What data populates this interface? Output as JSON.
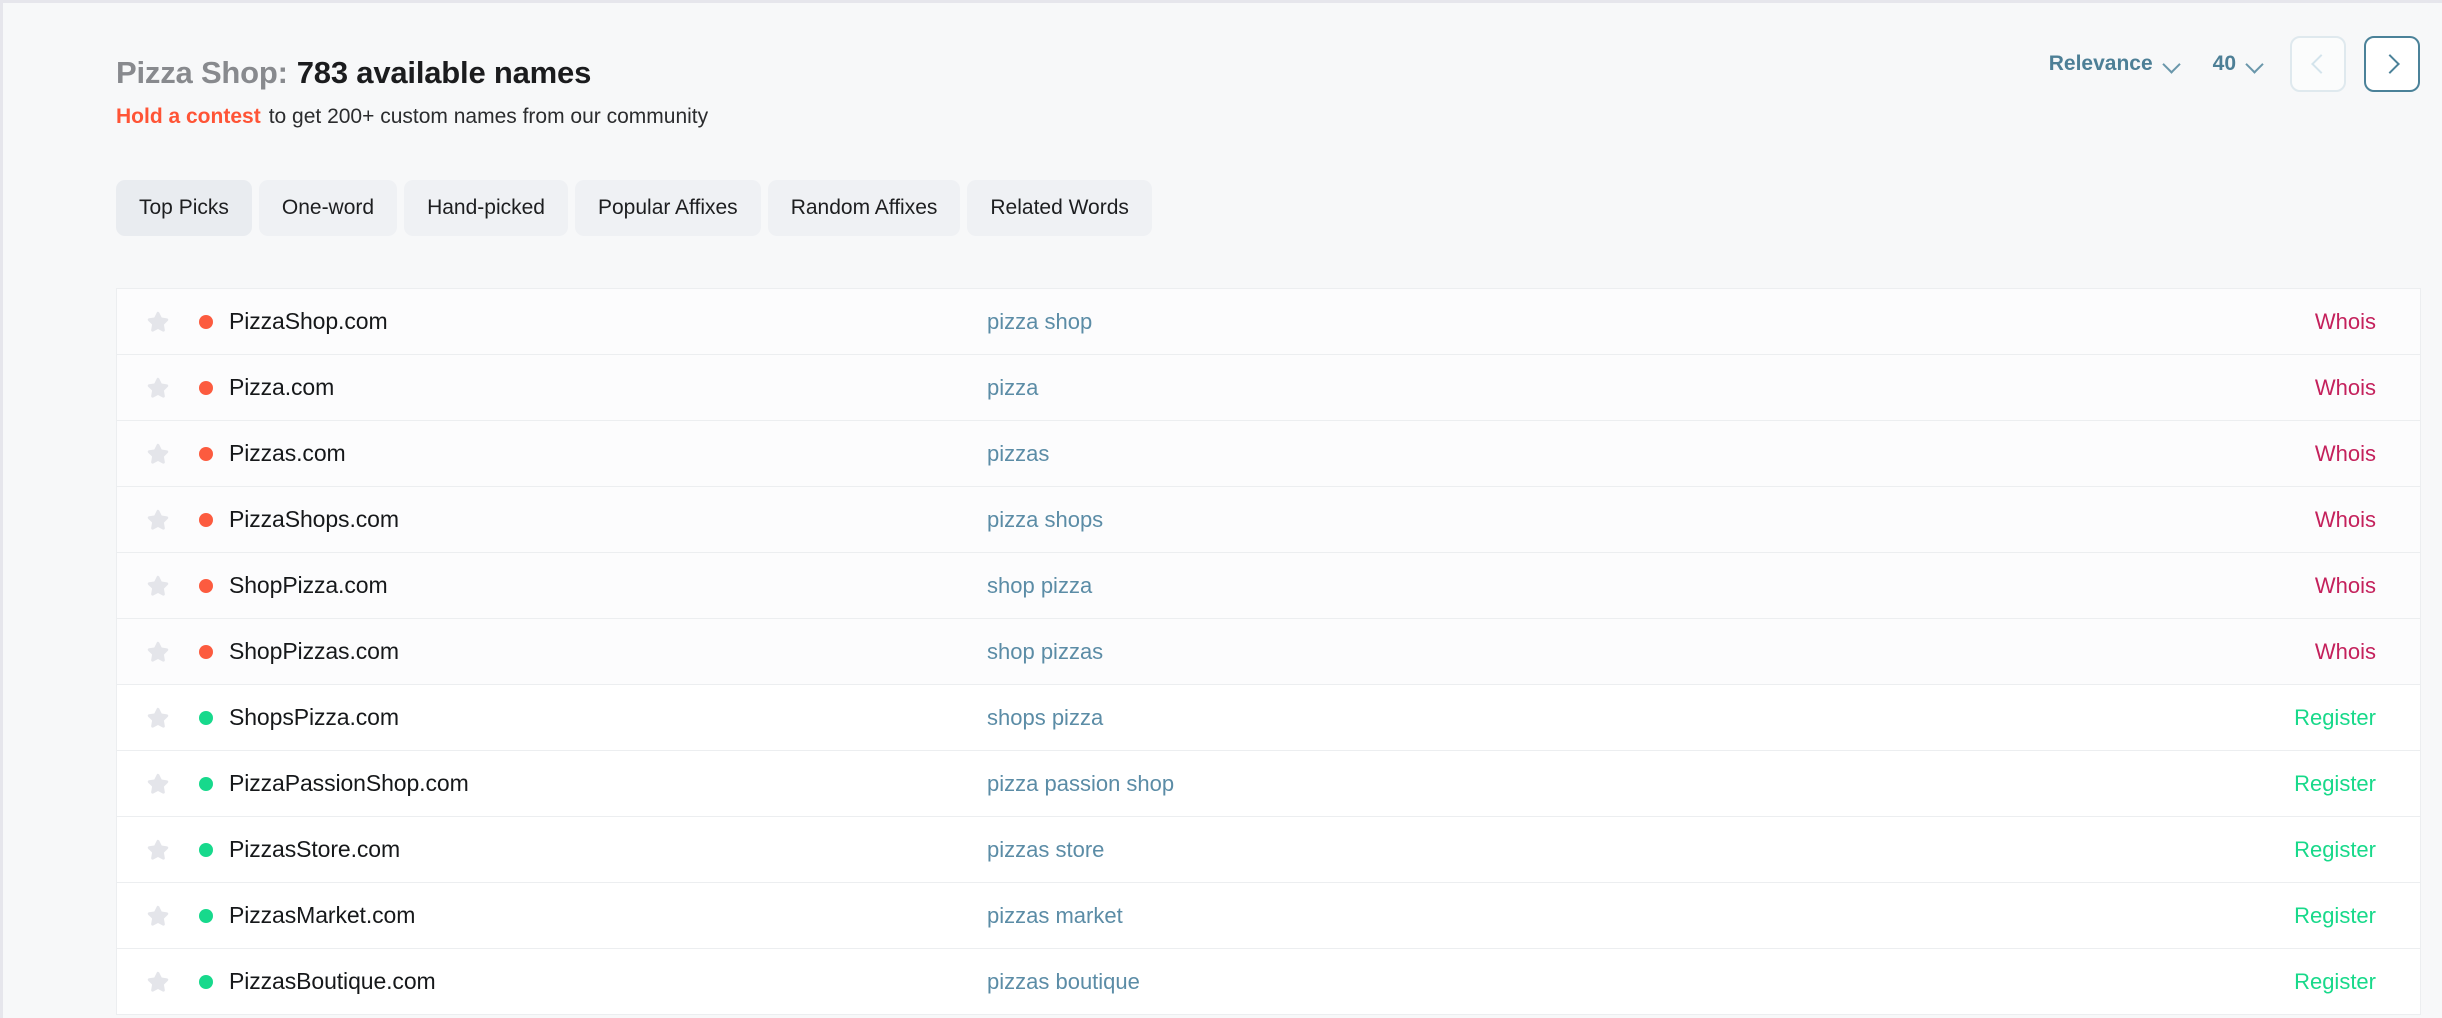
{
  "header": {
    "title_prefix": "Pizza Shop:",
    "title_main": "783 available names",
    "contest_link": "Hold a contest",
    "subtitle_text": "to get 200+ custom names from our community",
    "sort_value": "Relevance",
    "count_value": "40",
    "prev_icon": "chevron-left-icon",
    "next_icon": "chevron-right-icon"
  },
  "tabs": [
    {
      "label": "Top Picks",
      "active": true
    },
    {
      "label": "One-word",
      "active": false
    },
    {
      "label": "Hand-picked",
      "active": false
    },
    {
      "label": "Popular Affixes",
      "active": false
    },
    {
      "label": "Random Affixes",
      "active": false
    },
    {
      "label": "Related Words",
      "active": false
    }
  ],
  "colors": {
    "accent_orange": "#ff5436",
    "link_blue": "#5b8ca6",
    "whois_crimson": "#c4215c",
    "register_green": "#18d98a",
    "dot_taken": "#fc5b3f",
    "dot_available": "#17d98c",
    "star_gray": "#e4e5ea",
    "teal_control": "#4d7f96",
    "page_bg": "#f7f8f9"
  },
  "rows": [
    {
      "star": "star-icon",
      "status": "taken",
      "domain": "PizzaShop.com",
      "keyword": "pizza shop",
      "action": "Whois"
    },
    {
      "star": "star-icon",
      "status": "taken",
      "domain": "Pizza.com",
      "keyword": "pizza",
      "action": "Whois"
    },
    {
      "star": "star-icon",
      "status": "taken",
      "domain": "Pizzas.com",
      "keyword": "pizzas",
      "action": "Whois"
    },
    {
      "star": "star-icon",
      "status": "taken",
      "domain": "PizzaShops.com",
      "keyword": "pizza shops",
      "action": "Whois"
    },
    {
      "star": "star-icon",
      "status": "taken",
      "domain": "ShopPizza.com",
      "keyword": "shop pizza",
      "action": "Whois"
    },
    {
      "star": "star-icon",
      "status": "taken",
      "domain": "ShopPizzas.com",
      "keyword": "shop pizzas",
      "action": "Whois"
    },
    {
      "star": "star-icon",
      "status": "available",
      "domain": "ShopsPizza.com",
      "keyword": "shops pizza",
      "action": "Register"
    },
    {
      "star": "star-icon",
      "status": "available",
      "domain": "PizzaPassionShop.com",
      "keyword": "pizza passion shop",
      "action": "Register"
    },
    {
      "star": "star-icon",
      "status": "available",
      "domain": "PizzasStore.com",
      "keyword": "pizzas store",
      "action": "Register"
    },
    {
      "star": "star-icon",
      "status": "available",
      "domain": "PizzasMarket.com",
      "keyword": "pizzas market",
      "action": "Register"
    },
    {
      "star": "star-icon",
      "status": "available",
      "domain": "PizzasBoutique.com",
      "keyword": "pizzas boutique",
      "action": "Register"
    }
  ]
}
